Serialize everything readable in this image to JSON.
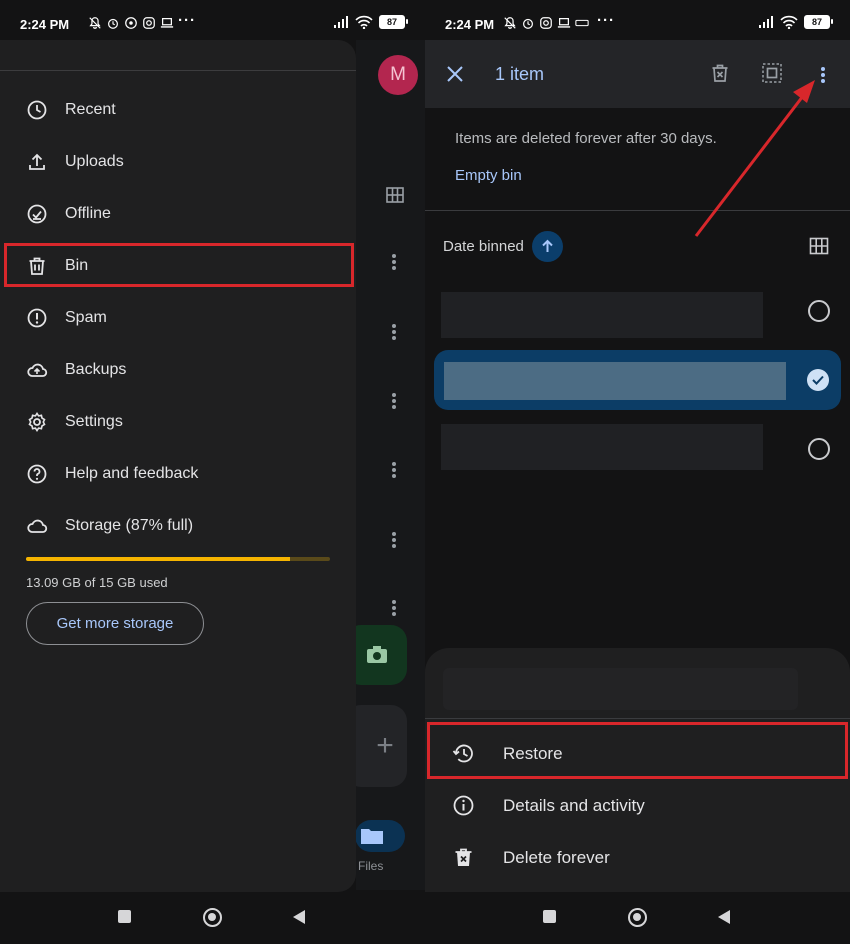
{
  "left": {
    "status": {
      "time": "2:24 PM",
      "battery": "87",
      "dots": "···"
    },
    "background_app": {
      "avatar_letter": "M",
      "files_label": "Files"
    },
    "drawer": {
      "items": [
        {
          "label": "Recent",
          "icon": "clock-icon"
        },
        {
          "label": "Uploads",
          "icon": "upload-icon"
        },
        {
          "label": "Offline",
          "icon": "offline-check-icon"
        },
        {
          "label": "Bin",
          "icon": "trash-icon"
        },
        {
          "label": "Spam",
          "icon": "spam-alert-icon"
        },
        {
          "label": "Backups",
          "icon": "cloud-upload-icon"
        },
        {
          "label": "Settings",
          "icon": "gear-icon"
        },
        {
          "label": "Help and feedback",
          "icon": "help-icon"
        },
        {
          "label": "Storage (87% full)",
          "icon": "cloud-icon"
        }
      ],
      "highlighted_item": "Bin",
      "storage": {
        "used_text": "13.09 GB of 15 GB used",
        "used_fraction": 0.87,
        "bar_color": "#f5b400"
      },
      "get_storage_label": "Get more storage"
    }
  },
  "right": {
    "status": {
      "time": "2:24 PM",
      "battery": "87",
      "dots": "···"
    },
    "selection_bar": {
      "title": "1 item"
    },
    "info_text": "Items are deleted forever after 30 days.",
    "empty_bin_label": "Empty bin",
    "sort": {
      "label": "Date binned",
      "direction": "ascending"
    },
    "files": [
      {
        "selected": false
      },
      {
        "selected": true
      },
      {
        "selected": false
      }
    ],
    "menu": [
      {
        "label": "Restore",
        "icon": "restore-history-icon"
      },
      {
        "label": "Details and activity",
        "icon": "info-icon"
      },
      {
        "label": "Delete forever",
        "icon": "delete-forever-icon"
      }
    ],
    "highlighted_menu_item": "Restore"
  },
  "colors": {
    "highlight": "#d8272b",
    "accent": "#a8c7fa",
    "background": "#131314"
  }
}
